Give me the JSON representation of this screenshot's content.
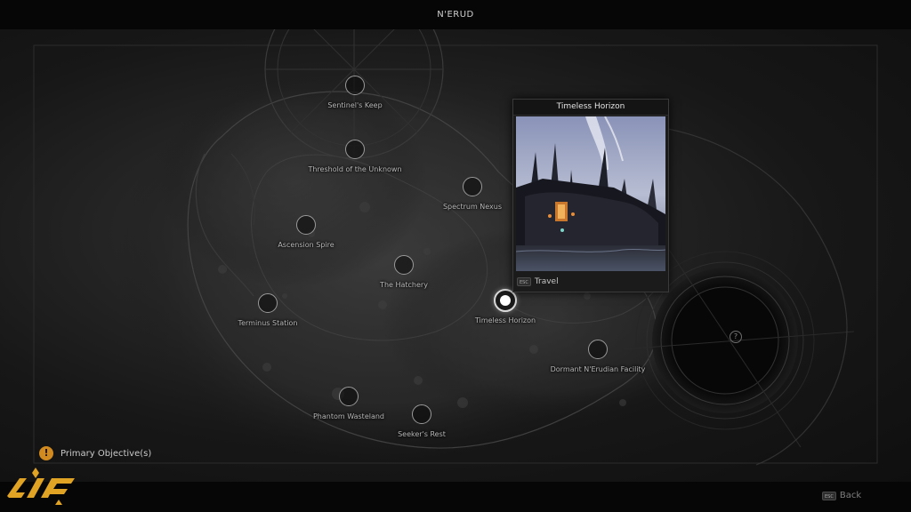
{
  "header": {
    "map_name": "N'ERUD"
  },
  "locations": [
    {
      "name": "Sentinel's Keep"
    },
    {
      "name": "Threshold of the Unknown"
    },
    {
      "name": "Spectrum Nexus"
    },
    {
      "name": "Ascension Spire"
    },
    {
      "name": "The Hatchery"
    },
    {
      "name": "Terminus Station"
    },
    {
      "name": "Timeless Horizon"
    },
    {
      "name": "Dormant N'Erudian Facility"
    },
    {
      "name": "Phantom Wasteland"
    },
    {
      "name": "Seeker's Rest"
    }
  ],
  "selected_location": "Timeless Horizon",
  "popup": {
    "title": "Timeless Horizon",
    "key": "ESC",
    "action_label": "Travel"
  },
  "unknown_marker": "?",
  "objective": {
    "icon": "exclamation-icon",
    "label": "Primary Objective(s)",
    "color": "#d08a1f"
  },
  "footer": {
    "back_key": "ESC",
    "back_label": "Back"
  },
  "colors": {
    "accent": "#d08a1f",
    "marker_selected": "#ffffff",
    "logo": "#e0a324"
  }
}
